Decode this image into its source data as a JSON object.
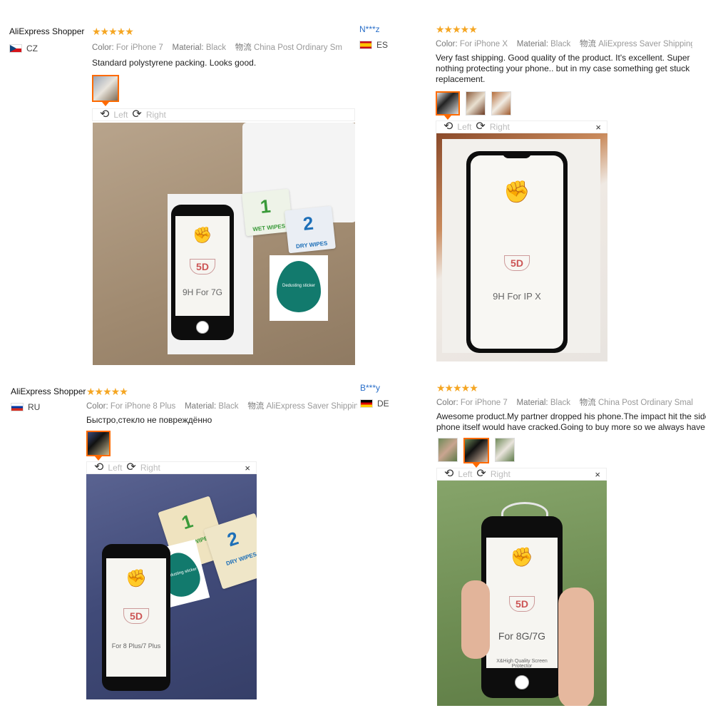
{
  "reviews": [
    {
      "author": "AliExpress Shopper",
      "country_code": "CZ",
      "stars": "★★★★★",
      "color_label": "Color:",
      "color_value": "For iPhone 7",
      "material_label": "Material:",
      "material_value": "Black",
      "shipping_label": "物流",
      "shipping_value": "China Post Ordinary Sm",
      "text_lines": [
        "Standard polystyrene packing. Looks good."
      ],
      "toolbar": {
        "left": "Left",
        "right": "Right"
      },
      "photo_model_text": "9H For 7G",
      "badge": "5D",
      "pack1": {
        "num": "1",
        "label": "WET WIPES"
      },
      "pack2": {
        "num": "2",
        "label": "DRY WIPES"
      },
      "sticker_label": "Dedusting sticker"
    },
    {
      "author": "N***z",
      "country_code": "ES",
      "stars": "★★★★★",
      "color_label": "Color:",
      "color_value": "For iPhone X",
      "material_label": "Material:",
      "material_value": "Black",
      "shipping_label": "物流",
      "shipping_value": "AliExpress Saver Shipping",
      "text_lines": [
        "Very fast shipping. Good quality of the product. It's excellent. Super sc",
        "nothing protecting your phone.. but in my case something get stuck b",
        "replacement."
      ],
      "toolbar": {
        "left": "Left",
        "right": "Right",
        "close": "×"
      },
      "photo_model_text": "9H For IP X",
      "badge": "5D"
    },
    {
      "author": "AliExpress Shopper",
      "country_code": "RU",
      "stars": "★★★★★",
      "color_label": "Color:",
      "color_value": "For iPhone 8 Plus",
      "material_label": "Material:",
      "material_value": "Black",
      "shipping_label": "物流",
      "shipping_value": "AliExpress Saver Shipping",
      "text_lines": [
        "Быстро,стекло не повреждённо"
      ],
      "toolbar": {
        "left": "Left",
        "right": "Right",
        "close": "×"
      },
      "photo_model_text": "For 8 Plus/7 Plus",
      "badge": "5D",
      "pack1": {
        "num": "1",
        "label": "WET WIPES"
      },
      "pack2": {
        "num": "2",
        "label": "DRY WIPES"
      },
      "sticker_label": "Dedusting sticker"
    },
    {
      "author": "B***y",
      "country_code": "DE",
      "stars": "★★★★★",
      "color_label": "Color:",
      "color_value": "For iPhone 7",
      "material_label": "Material:",
      "material_value": "Black",
      "shipping_label": "物流",
      "shipping_value": "China Post Ordinary Small",
      "text_lines": [
        "Awesome product.My partner dropped his phone.The impact hit the side",
        "phone itself would have cracked.Going to buy more so we always have on"
      ],
      "toolbar": {
        "left": "Left",
        "right": "Right",
        "close": "×"
      },
      "photo_model_text": "For 8G/7G",
      "badge": "5D",
      "photo_footer": "X&High Quality Screen Protector"
    }
  ]
}
